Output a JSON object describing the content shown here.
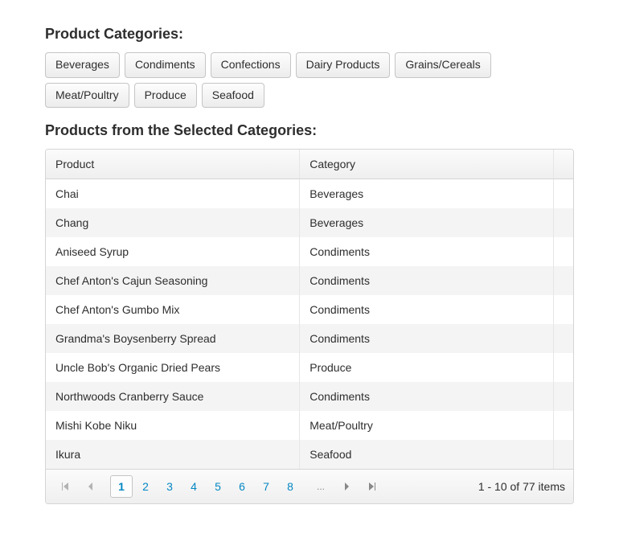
{
  "headings": {
    "categories": "Product Categories:",
    "products": "Products from the Selected Categories:"
  },
  "categoryButtons": [
    "Beverages",
    "Condiments",
    "Confections",
    "Dairy Products",
    "Grains/Cereals",
    "Meat/Poultry",
    "Produce",
    "Seafood"
  ],
  "grid": {
    "columns": [
      "Product",
      "Category"
    ],
    "rows": [
      {
        "product": "Chai",
        "category": "Beverages"
      },
      {
        "product": "Chang",
        "category": "Beverages"
      },
      {
        "product": "Aniseed Syrup",
        "category": "Condiments"
      },
      {
        "product": "Chef Anton's Cajun Seasoning",
        "category": "Condiments"
      },
      {
        "product": "Chef Anton's Gumbo Mix",
        "category": "Condiments"
      },
      {
        "product": "Grandma's Boysenberry Spread",
        "category": "Condiments"
      },
      {
        "product": "Uncle Bob's Organic Dried Pears",
        "category": "Produce"
      },
      {
        "product": "Northwoods Cranberry Sauce",
        "category": "Condiments"
      },
      {
        "product": "Mishi Kobe Niku",
        "category": "Meat/Poultry"
      },
      {
        "product": "Ikura",
        "category": "Seafood"
      }
    ]
  },
  "pager": {
    "pages": [
      "1",
      "2",
      "3",
      "4",
      "5",
      "6",
      "7",
      "8"
    ],
    "currentPage": "1",
    "info": "1 - 10 of 77 items"
  }
}
